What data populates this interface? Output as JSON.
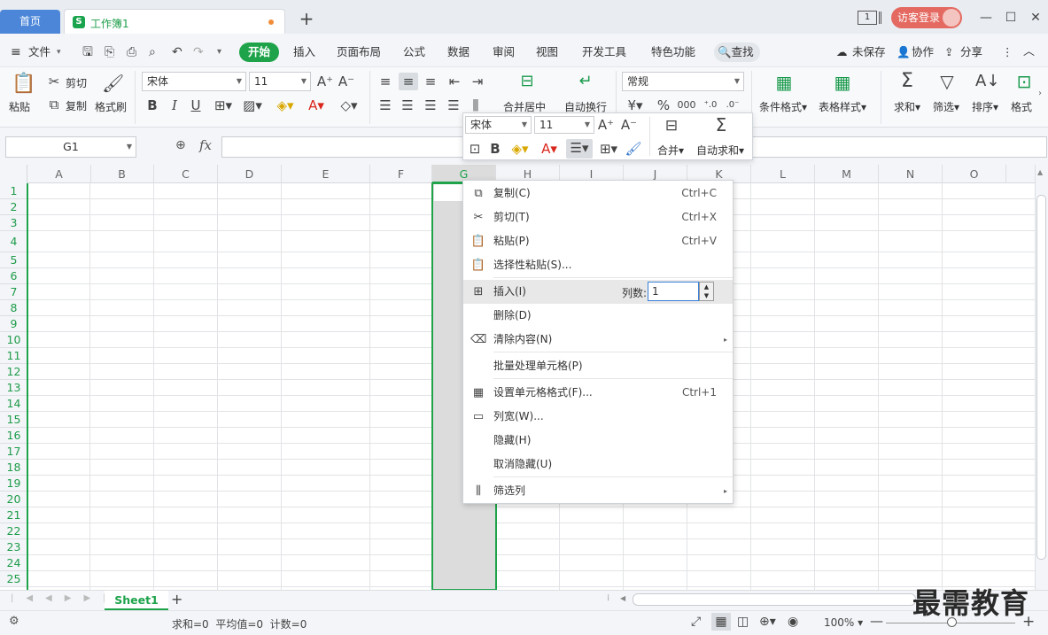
{
  "title_bar": {
    "home_tab": "首页",
    "doc_tab": "工作簿1",
    "doc_logo": "S",
    "window_count": "1",
    "login": "访客登录",
    "min": "—",
    "max": "☐",
    "close": "✕"
  },
  "menu": {
    "file": "文件",
    "items": [
      "开始",
      "插入",
      "页面布局",
      "公式",
      "数据",
      "审阅",
      "视图",
      "开发工具",
      "特色功能"
    ],
    "search": "查找",
    "right": [
      "未保存",
      "协作",
      "分享"
    ]
  },
  "ribbon": {
    "paste": "粘贴",
    "cut": "剪切",
    "copy": "复制",
    "format_painter": "格式刷",
    "font": "宋体",
    "size": "11",
    "merge_center": "合并居中",
    "auto_wrap": "自动换行",
    "number_format": "常规",
    "cond_format": "条件格式",
    "table_style": "表格样式",
    "sum": "求和",
    "filter": "筛选",
    "sort": "排序",
    "format": "格式"
  },
  "formula_bar": {
    "name_box": "G1",
    "fx": "fx"
  },
  "columns": [
    "A",
    "B",
    "C",
    "D",
    "E",
    "F",
    "G",
    "H",
    "I",
    "J",
    "K",
    "L",
    "M",
    "N",
    "O"
  ],
  "rows": [
    "1",
    "2",
    "3",
    "4",
    "5",
    "6",
    "7",
    "8",
    "9",
    "10",
    "11",
    "12",
    "13",
    "14",
    "15",
    "16",
    "17",
    "18",
    "19",
    "20",
    "21",
    "22",
    "23",
    "24",
    "25"
  ],
  "mini_toolbar": {
    "font": "宋体",
    "size": "11",
    "merge": "合并",
    "autosum": "自动求和"
  },
  "context_menu": [
    {
      "label": "复制(C)",
      "shortcut": "Ctrl+C",
      "icon": "copy-icon"
    },
    {
      "label": "剪切(T)",
      "shortcut": "Ctrl+X",
      "icon": "cut-icon"
    },
    {
      "label": "粘贴(P)",
      "shortcut": "Ctrl+V",
      "icon": "paste-icon"
    },
    {
      "label": "选择性粘贴(S)...",
      "shortcut": "",
      "icon": "paste-special-icon"
    },
    {
      "label": "插入(I)",
      "shortcut": "",
      "icon": "insert-icon"
    },
    {
      "label": "删除(D)",
      "shortcut": "",
      "icon": ""
    },
    {
      "label": "清除内容(N)",
      "shortcut": "",
      "icon": "eraser-icon"
    },
    {
      "label": "批量处理单元格(P)",
      "shortcut": "",
      "icon": ""
    },
    {
      "label": "设置单元格格式(F)...",
      "shortcut": "Ctrl+1",
      "icon": "format-cells-icon"
    },
    {
      "label": "列宽(W)...",
      "shortcut": "",
      "icon": "column-width-icon"
    },
    {
      "label": "隐藏(H)",
      "shortcut": "",
      "icon": ""
    },
    {
      "label": "取消隐藏(U)",
      "shortcut": "",
      "icon": ""
    },
    {
      "label": "筛选列",
      "shortcut": "",
      "icon": "filter-column-icon"
    }
  ],
  "insert_cols_label": "列数:",
  "insert_cols_value": "1",
  "sheet_tab": "Sheet1",
  "status": {
    "text": "求和=0  平均值=0  计数=0",
    "zoom": "100%"
  },
  "watermark": "最需教育",
  "colors": {
    "accent": "#1fa34a",
    "home_tab": "#4b86d9",
    "login": "#e46a61"
  }
}
